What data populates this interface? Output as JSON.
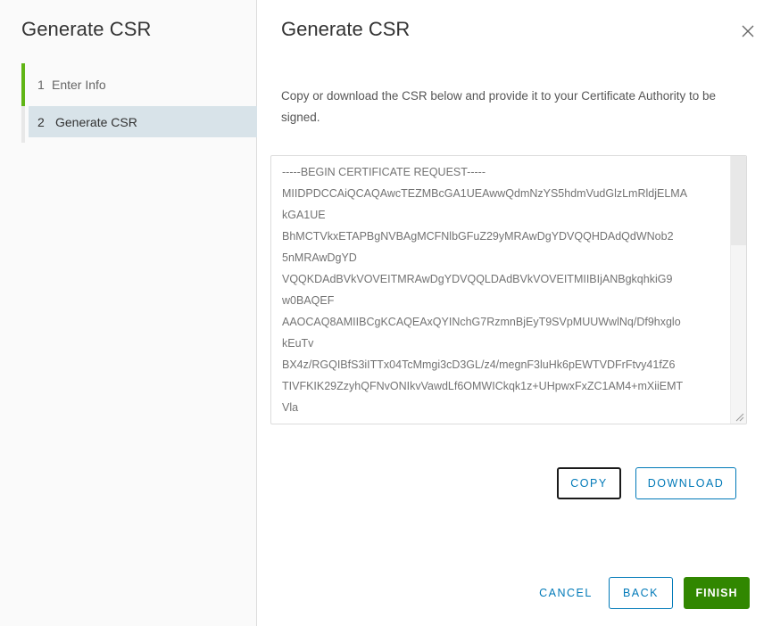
{
  "nav": {
    "title": "Generate CSR",
    "steps": [
      {
        "number": "1",
        "label": "Enter Info",
        "state": "completed"
      },
      {
        "number": "2",
        "label": "Generate CSR",
        "state": "active"
      }
    ]
  },
  "content": {
    "title": "Generate CSR",
    "close_icon": "close-icon",
    "description": "Copy or download the CSR below and provide it to your Certificate Authority to be signed.",
    "csr_lines": [
      "-----BEGIN CERTIFICATE REQUEST-----",
      "MIIDPDCCAiQCAQAwcTEZMBcGA1UEAwwQdmNzYS5hdmVudGlzLmRldjELMA",
      "kGA1UE",
      "BhMCTVkxETAPBgNVBAgMCFNlbGFuZ29yMRAwDgYDVQQHDAdQdWNob2",
      "5nMRAwDgYD",
      "VQQKDAdBVkVOVEITMRAwDgYDVQQLDAdBVkVOVEITMIIBIjANBgkqhkiG9",
      "w0BAQEF",
      "AAOCAQ8AMIIBCgKCAQEAxQYINchG7RzmnBjEyT9SVpMUUWwlNq/Df9hxglo",
      "kEuTv",
      "BX4z/RGQIBfS3iITTx04TcMmgi3cD3GL/z4/megnF3luHk6pEWTVDFrFtvy41fZ6",
      "TIVFKIK29ZzyhQFNvONIkvVawdLf6OMWICkqk1z+UHpwxFxZC1AM4+mXiiEMT",
      "Vla"
    ],
    "copy_label": "COPY",
    "download_label": "DOWNLOAD"
  },
  "footer": {
    "cancel_label": "CANCEL",
    "back_label": "BACK",
    "finish_label": "FINISH"
  },
  "colors": {
    "accent": "#0079b8",
    "primary_button": "#318700",
    "step_complete_bar": "#60b515",
    "active_step_bg": "#d8e3e9"
  }
}
